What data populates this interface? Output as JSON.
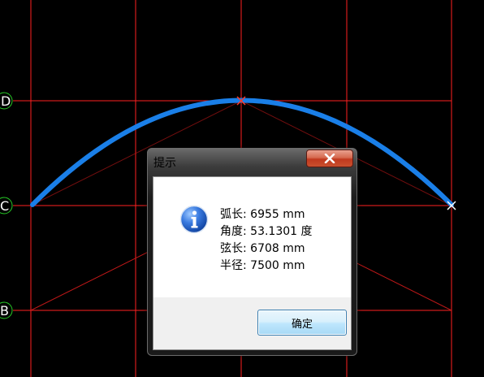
{
  "drawing": {
    "background_color": "#000000",
    "grid_color": "#ff2020",
    "arc_color": "#1a7fe8",
    "axis_color": "#26c926",
    "axis_labels": [
      "D",
      "C",
      "B"
    ]
  },
  "dialog": {
    "title": "提示",
    "icon": "info-icon",
    "lines": [
      "弧长: 6955 mm",
      "角度: 53.1301 度",
      "弦长: 6708 mm",
      "半径: 7500 mm"
    ],
    "ok_label": "确定"
  }
}
